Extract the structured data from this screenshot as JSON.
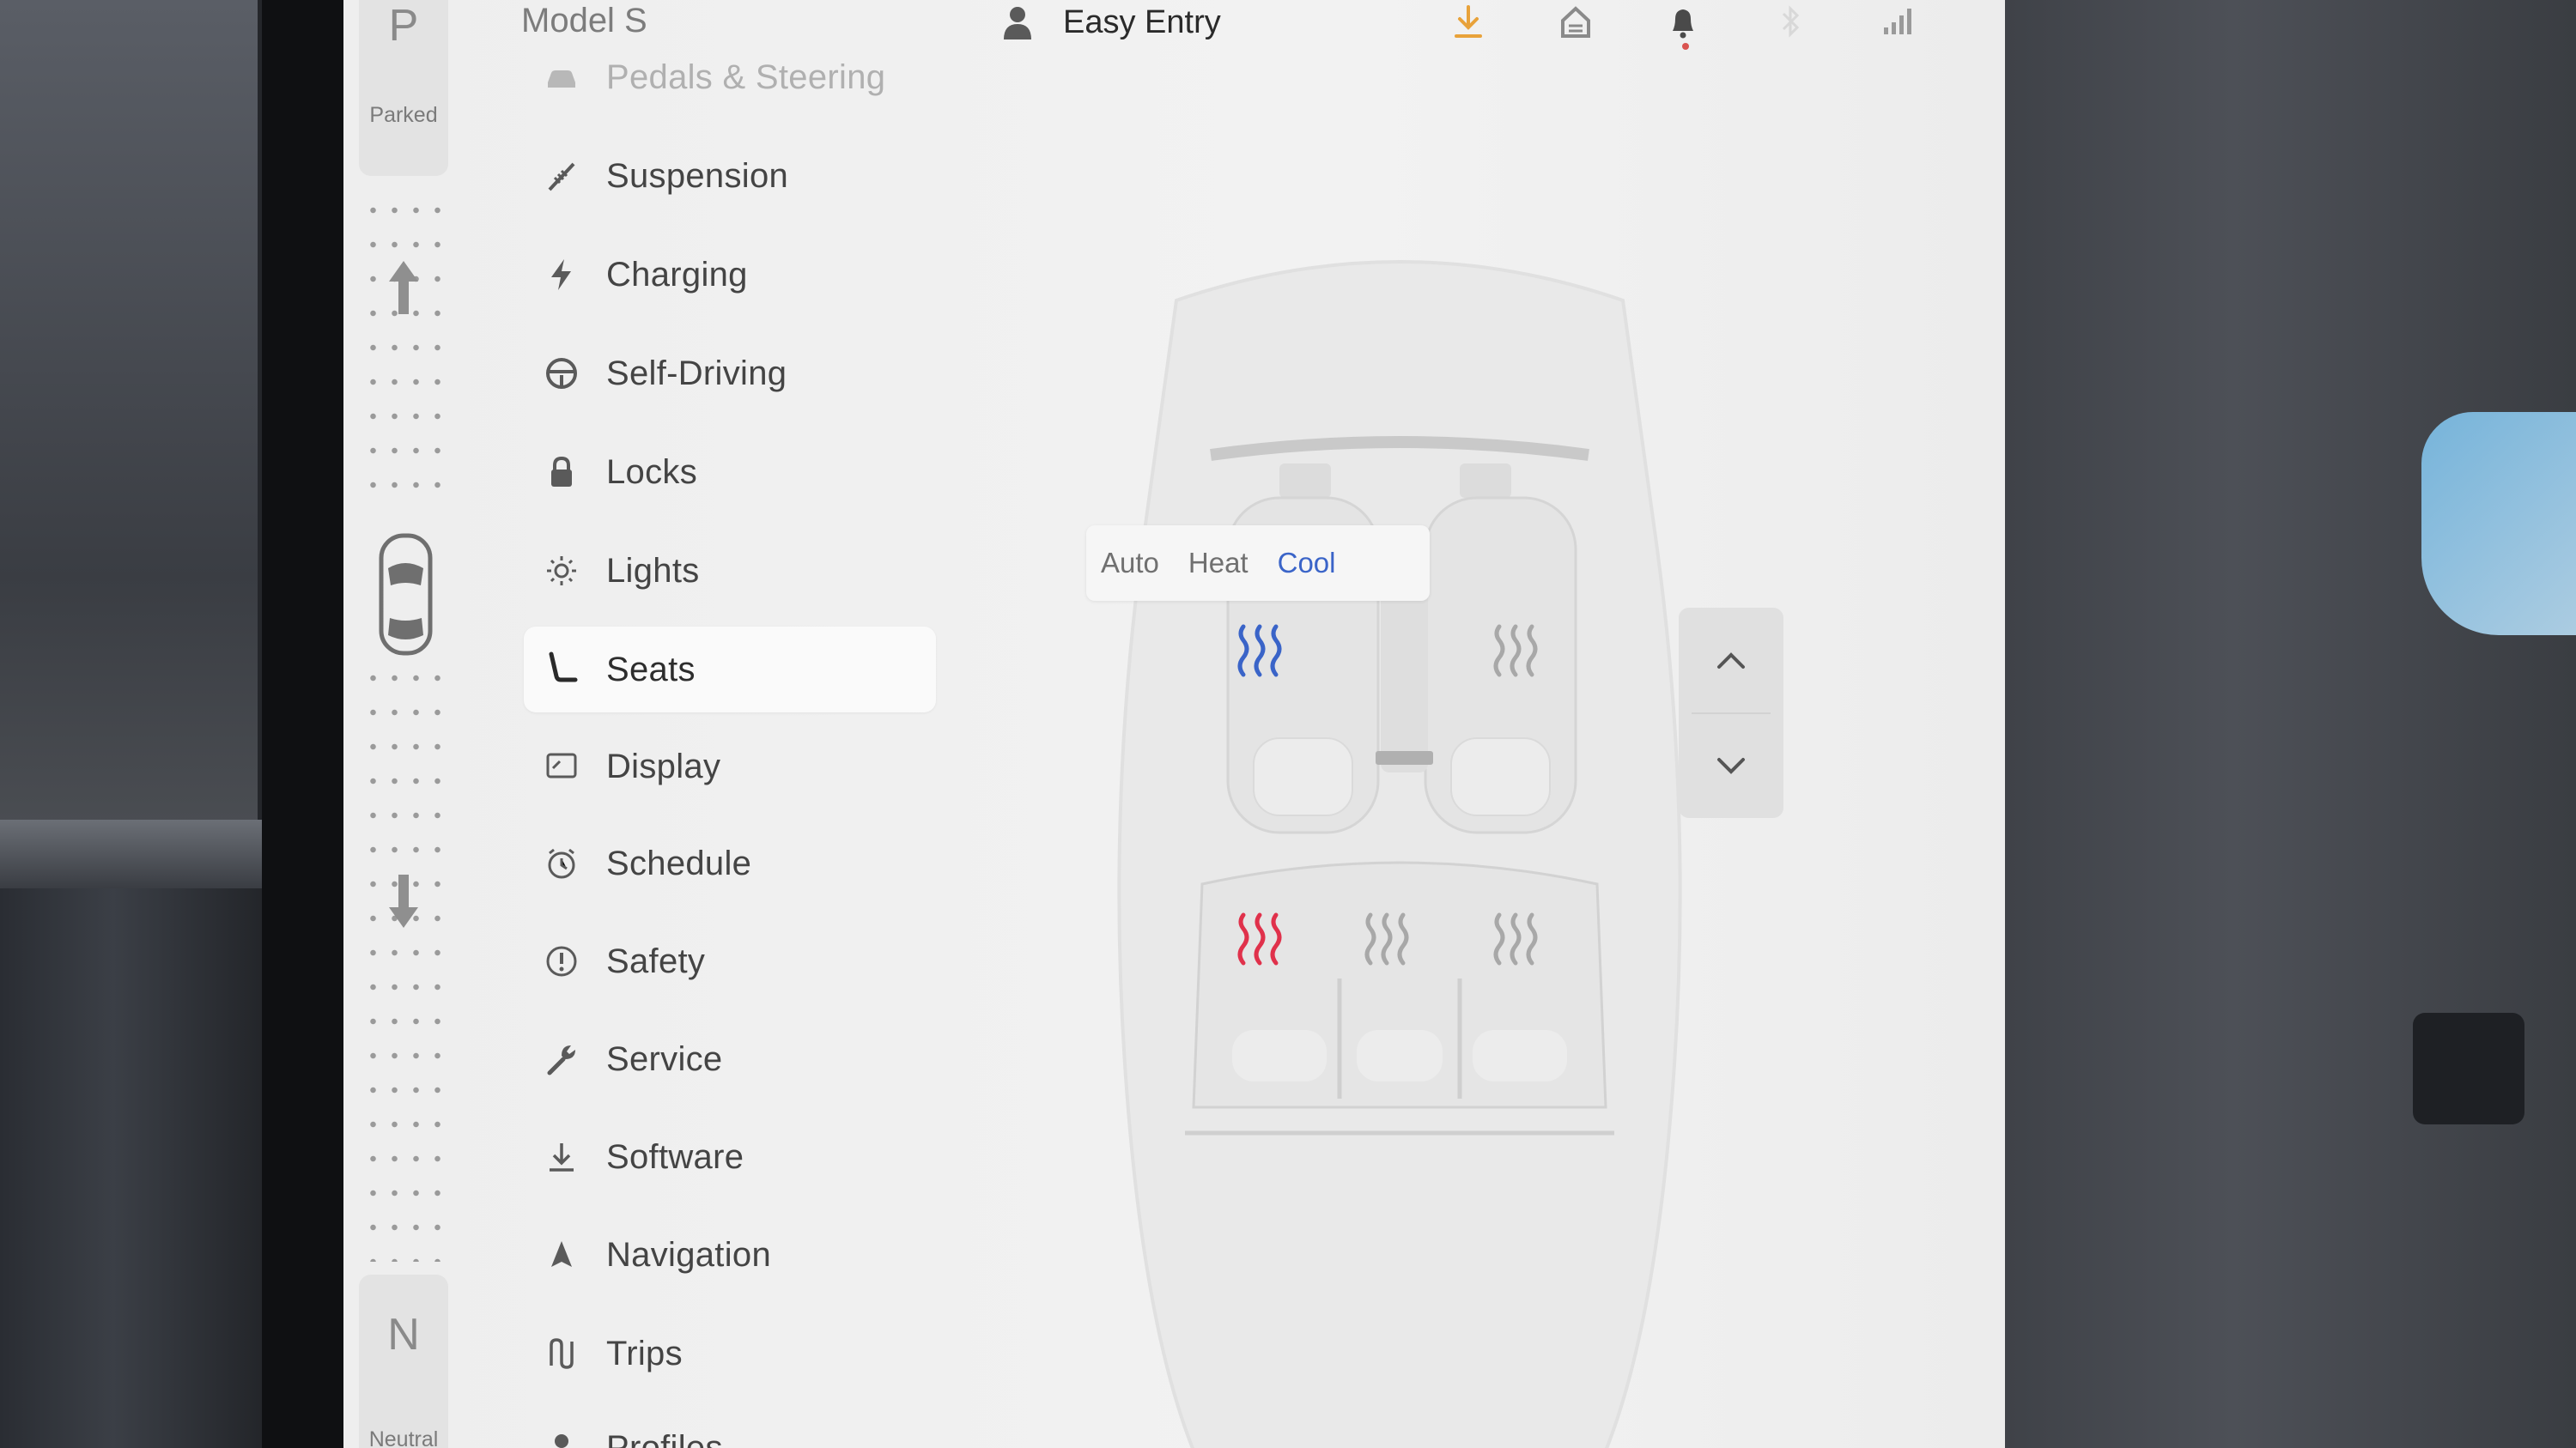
{
  "gear": {
    "park_letter": "P",
    "park_label": "Parked",
    "neutral_letter": "N",
    "neutral_label": "Neutral"
  },
  "status_bar": {
    "car_name": "Model S",
    "profile_name": "Easy Entry",
    "icons": [
      "download-icon",
      "home-icon",
      "bell-icon",
      "bluetooth-icon",
      "signal-icon"
    ]
  },
  "menu": {
    "items": [
      {
        "label": "Pedals & Steering",
        "icon": "car-icon"
      },
      {
        "label": "Suspension",
        "icon": "suspension-icon"
      },
      {
        "label": "Charging",
        "icon": "bolt-icon"
      },
      {
        "label": "Self-Driving",
        "icon": "steering-wheel-icon"
      },
      {
        "label": "Locks",
        "icon": "lock-icon"
      },
      {
        "label": "Lights",
        "icon": "light-icon"
      },
      {
        "label": "Seats",
        "icon": "seat-icon"
      },
      {
        "label": "Display",
        "icon": "display-icon"
      },
      {
        "label": "Schedule",
        "icon": "alarm-icon"
      },
      {
        "label": "Safety",
        "icon": "alert-icon"
      },
      {
        "label": "Service",
        "icon": "wrench-icon"
      },
      {
        "label": "Software",
        "icon": "download-icon"
      },
      {
        "label": "Navigation",
        "icon": "navigation-icon"
      },
      {
        "label": "Trips",
        "icon": "trips-icon"
      },
      {
        "label": "Profiles",
        "icon": "profile-icon"
      }
    ],
    "selected": "Seats"
  },
  "seats": {
    "modes": [
      "Auto",
      "Heat",
      "Cool"
    ],
    "active_mode": "Cool",
    "seat_states": {
      "driver": "cool",
      "front_passenger": "off",
      "rear_left": "heat",
      "rear_center": "off",
      "rear_right": "off"
    }
  },
  "colors": {
    "cool": "#3a64c8",
    "heat": "#e0314b",
    "off": "#a8a8a8",
    "accent": "#3a64c8"
  }
}
